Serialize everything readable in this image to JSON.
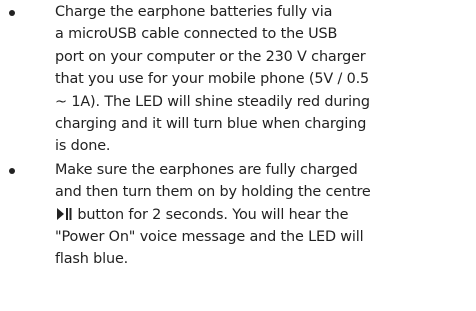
{
  "bullets": [
    {
      "lines": [
        "Charge the earphone batteries fully via",
        "a microUSB cable connected to the USB",
        "port on your computer or the 230 V charger",
        "that you use for your mobile phone (5V / 0.5",
        "~ 1A). The LED will shine steadily red during",
        "charging and it will turn blue when charging",
        "is done."
      ]
    },
    {
      "lines": [
        "Make sure the earphones are fully charged",
        "and then turn them on by holding the centre"
      ],
      "icon_line_after": " button for 2 seconds. You will hear the",
      "lines_after": [
        "\"Power On\" voice message and the LED will",
        "flash blue."
      ],
      "icon": "play-pause-icon"
    }
  ]
}
